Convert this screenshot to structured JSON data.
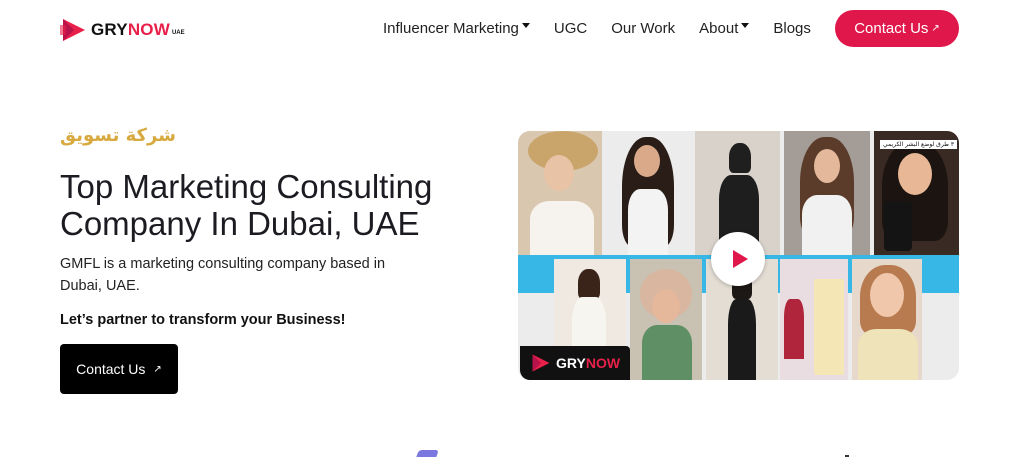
{
  "logo": {
    "brand_main": "GRY",
    "brand_accent": "NOW",
    "suffix": "UAE"
  },
  "nav": {
    "items": [
      {
        "label": "Influencer Marketing",
        "has_dropdown": true
      },
      {
        "label": "UGC",
        "has_dropdown": false
      },
      {
        "label": "Our Work",
        "has_dropdown": false
      },
      {
        "label": "About",
        "has_dropdown": true
      },
      {
        "label": "Blogs",
        "has_dropdown": false
      }
    ],
    "contact_label": "Contact Us",
    "contact_arrow": "↗"
  },
  "hero": {
    "arabic_tagline": "شركة تسويق",
    "title": "Top Marketing Consulting Company In Dubai, UAE",
    "description": "GMFL is a marketing consulting company based in Dubai, UAE.",
    "cta_text": "Let’s partner to transform your Business!",
    "button_label": "Contact Us",
    "button_arrow": "↗"
  },
  "video": {
    "logo_main": "GRY",
    "logo_accent": "NOW",
    "caption": "٣ طرق لوضع البشر الكريمي"
  },
  "colors": {
    "accent": "#e0174a",
    "arabic_gold": "#d8a93e",
    "band_blue": "#36b7e6",
    "button_dark": "#000000"
  }
}
